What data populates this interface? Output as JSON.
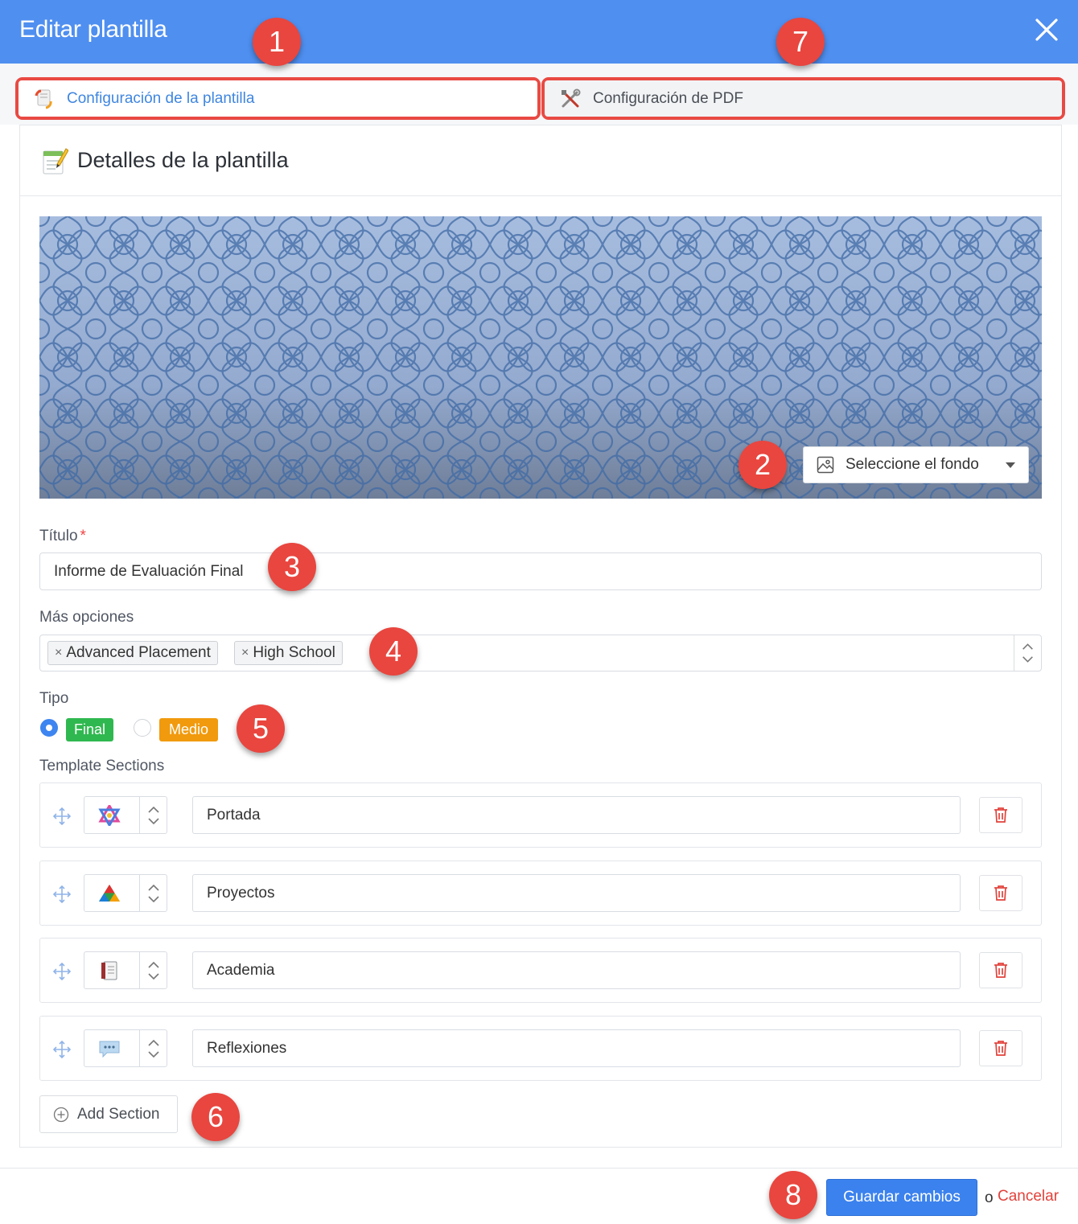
{
  "dialog": {
    "title": "Editar plantilla"
  },
  "tabs": [
    {
      "label": "Configuración de la plantilla",
      "active": true
    },
    {
      "label": "Configuración de PDF",
      "active": false
    }
  ],
  "panel": {
    "title": "Detalles de la plantilla"
  },
  "background": {
    "select_label": "Seleccione el fondo"
  },
  "form": {
    "title_label": "Título",
    "title_required_mark": "*",
    "title_value": "Informe de Evaluación Final",
    "options_label": "Más opciones",
    "options_tags": [
      "Advanced Placement",
      "High School"
    ],
    "tag_remove_glyph": "×",
    "type_label": "Tipo",
    "type_options": [
      {
        "label": "Final",
        "selected": true,
        "color": "#2fb84f"
      },
      {
        "label": "Medio",
        "selected": false,
        "color": "#f19a0d"
      }
    ],
    "sections_label": "Template Sections",
    "sections": [
      {
        "name": "Portada",
        "icon": "star-of-david-icon"
      },
      {
        "name": "Proyectos",
        "icon": "abc-triangle-icon"
      },
      {
        "name": "Academia",
        "icon": "notebook-icon"
      },
      {
        "name": "Reflexiones",
        "icon": "speech-bubble-icon"
      }
    ],
    "add_section_label": "Add Section"
  },
  "footer": {
    "save_label": "Guardar cambios",
    "or_text": "o",
    "cancel_label": "Cancelar"
  },
  "callouts": [
    "1",
    "2",
    "3",
    "4",
    "5",
    "6",
    "7",
    "8"
  ],
  "colors": {
    "header": "#4f8ff0",
    "accent": "#3b82ee",
    "callout": "#e8463f",
    "danger": "#e2423b"
  }
}
